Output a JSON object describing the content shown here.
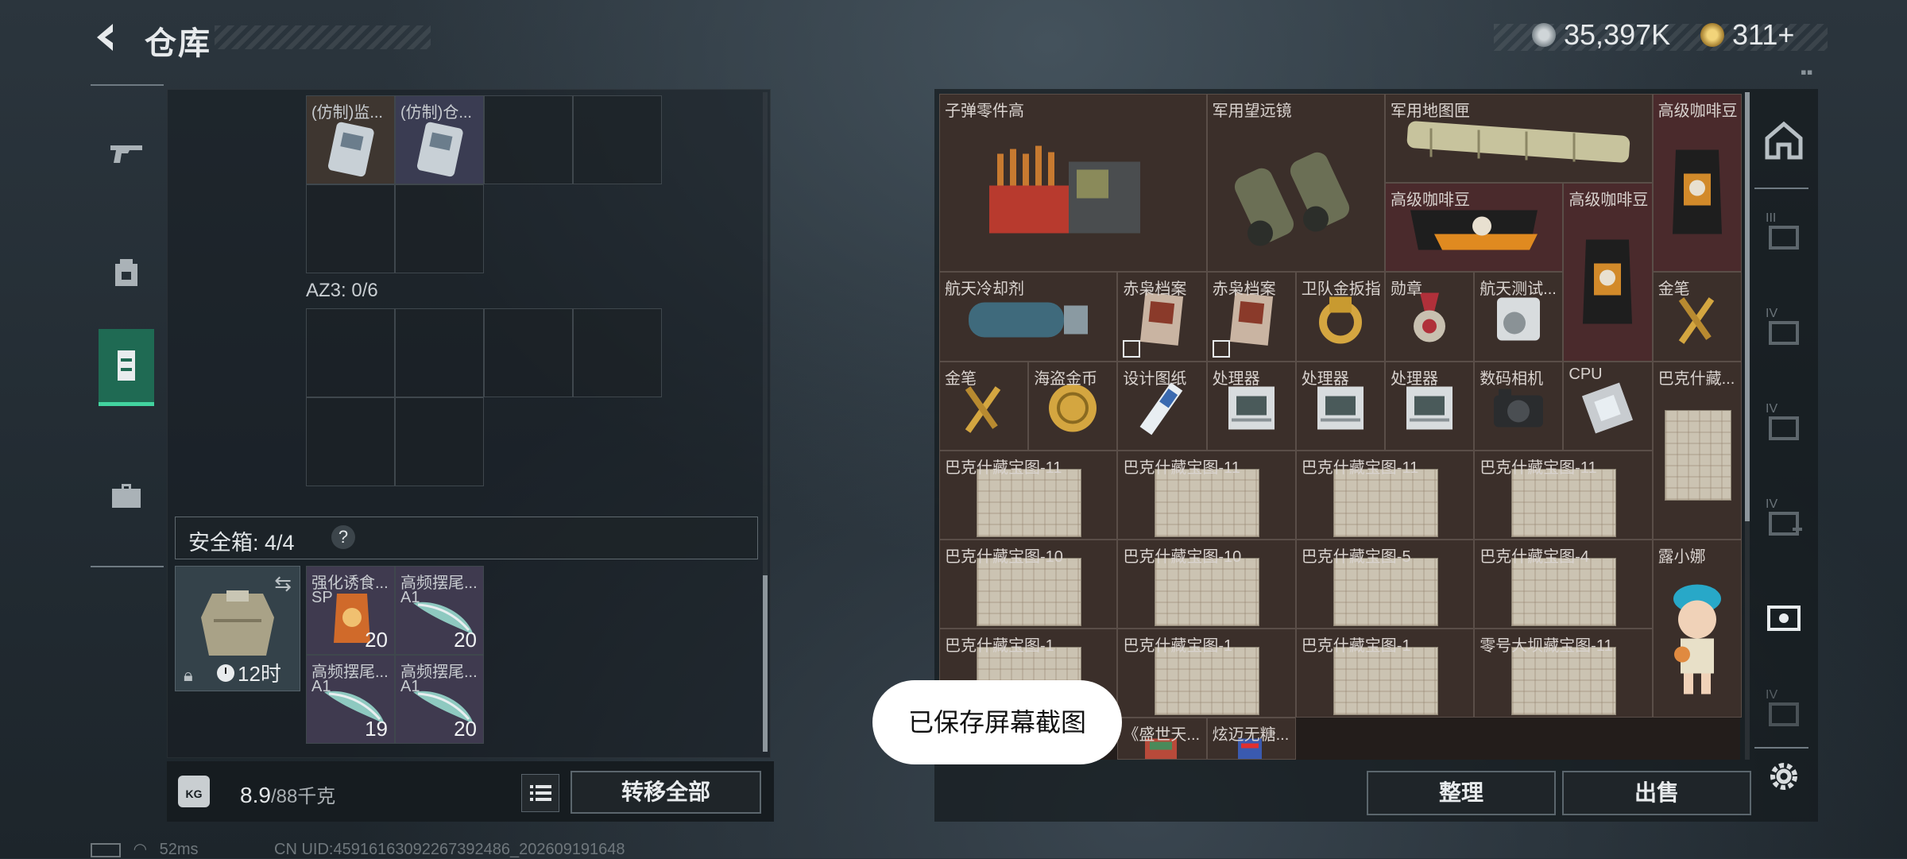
{
  "header": {
    "title": "仓库",
    "silver": "35,397K",
    "gold": "311+"
  },
  "left_panel": {
    "top_container_items": [
      {
        "name": "(仿制)监..."
      },
      {
        "name": "(仿制)仓..."
      }
    ],
    "az3_label": "AZ3: 0/6",
    "safe_box": {
      "label": "安全箱: 4/4",
      "help": "?",
      "timer": "12时"
    },
    "safe_items": [
      {
        "name": "强化诱食...",
        "sub": "SP",
        "count": "20"
      },
      {
        "name": "高频摆尾...",
        "sub": "A1",
        "count": "20"
      },
      {
        "name": "高频摆尾...",
        "sub": "A1",
        "count": "19"
      },
      {
        "name": "高频摆尾...",
        "sub": "A1",
        "count": "20"
      }
    ],
    "weight": "8.9",
    "weight_max": "/88千克",
    "transfer_all": "转移全部",
    "kg_badge": "KG"
  },
  "right_panel": {
    "items": [
      {
        "name": "子弹零件高"
      },
      {
        "name": "军用望远镜"
      },
      {
        "name": "军用地图匣"
      },
      {
        "name": "高级咖啡豆"
      },
      {
        "name": "高级咖啡豆"
      },
      {
        "name": "高级咖啡豆"
      },
      {
        "name": "航天冷却剂"
      },
      {
        "name": "赤枭档案"
      },
      {
        "name": "赤枭档案"
      },
      {
        "name": "卫队金扳指"
      },
      {
        "name": "勋章"
      },
      {
        "name": "航天测试..."
      },
      {
        "name": "金笔"
      },
      {
        "name": "金笔"
      },
      {
        "name": "海盗金币"
      },
      {
        "name": "设计图纸"
      },
      {
        "name": "处理器"
      },
      {
        "name": "处理器"
      },
      {
        "name": "处理器"
      },
      {
        "name": "数码相机"
      },
      {
        "name": "CPU"
      },
      {
        "name": "巴克什藏..."
      },
      {
        "name": "巴克什藏宝图-11"
      },
      {
        "name": "巴克什藏宝图-11"
      },
      {
        "name": "巴克什藏宝图-11"
      },
      {
        "name": "巴克什藏宝图-11"
      },
      {
        "name": "巴克什藏宝图-10"
      },
      {
        "name": "巴克什藏宝图-10"
      },
      {
        "name": "巴克什藏宝图-5"
      },
      {
        "name": "巴克什藏宝图-4"
      },
      {
        "name": "露小娜"
      },
      {
        "name": "巴克什藏宝图-1"
      },
      {
        "name": "巴克什藏宝图-1"
      },
      {
        "name": "巴克什藏宝图-1"
      },
      {
        "name": "零号大坝藏宝图-11"
      },
      {
        "name": "《盛世天..."
      },
      {
        "name": "炫迈无糖..."
      }
    ],
    "sort_label": "整理",
    "sell_label": "出售"
  },
  "side_tabs": [
    "III",
    "IV",
    "IV",
    "IV",
    "",
    "IV"
  ],
  "toast": "已保存屏幕截图",
  "status_bar": {
    "ping": "52ms",
    "uid": "CN UID:45916163092267392486_202609191648"
  },
  "colors": {
    "accent_green": "#42d39f",
    "nav_active": "#1f6a53",
    "item_brown": "#3b2f2a",
    "item_red": "#4a2a2c"
  }
}
